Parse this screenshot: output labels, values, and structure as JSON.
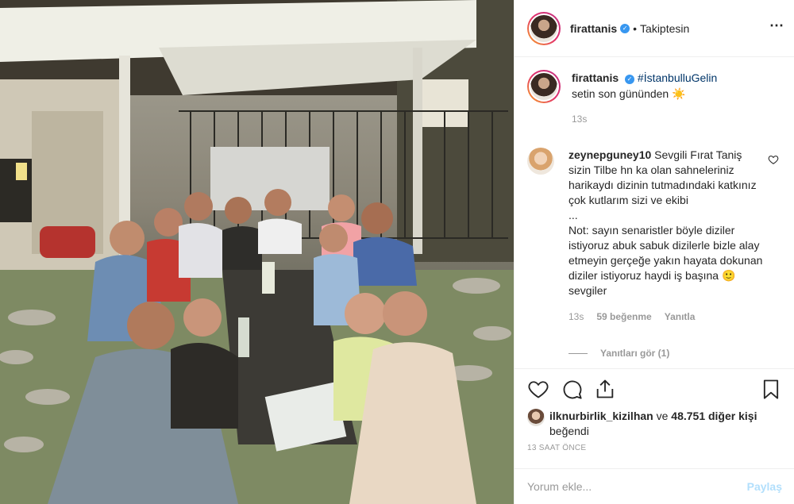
{
  "post": {
    "username": "firattanis",
    "verified": true,
    "follow_state": "Takiptesin",
    "dot": "•",
    "more_icon": "⋯"
  },
  "caption": {
    "username": "firattanis",
    "hashtag": "#İstanbulluGelin",
    "text": "setin son gününden ☀️",
    "time": "13s"
  },
  "comment": {
    "username": "zeynepguney10",
    "text": "Sevgili Fırat Taniş sizin Tilbe hn ka olan sahneleriniz harikaydı dizinin tutmadındaki katkınız çok kutlarım sizi ve ekibi\n...\nNot: sayın senaristler böyle diziler istiyoruz abuk sabuk dizilerle bizle alay etmeyin gerçeğe yakın hayata dokunan diziler istiyoruz haydi iş başına 🙂 sevgiler",
    "time": "13s",
    "likes": "59 beğenme",
    "reply": "Yanıtla",
    "view_replies": "Yanıtları gör (1)"
  },
  "likes": {
    "first_user": "ilknurbirlik_kizilhan",
    "connector": " ve ",
    "others": "48.751 diğer kişi",
    "suffix": "beğendi"
  },
  "post_time": "13 SAAT ÖNCE",
  "add_comment": {
    "placeholder": "Yorum ekle...",
    "post_label": "Paylaş"
  },
  "icons": {
    "like": "heart-icon",
    "comment": "comment-icon",
    "share": "share-icon",
    "save": "bookmark-icon",
    "more": "more-icon"
  },
  "colors": {
    "accent": "#3897f0",
    "hashtag": "#003569",
    "muted": "#999999",
    "post_button": "#b2dffc"
  }
}
